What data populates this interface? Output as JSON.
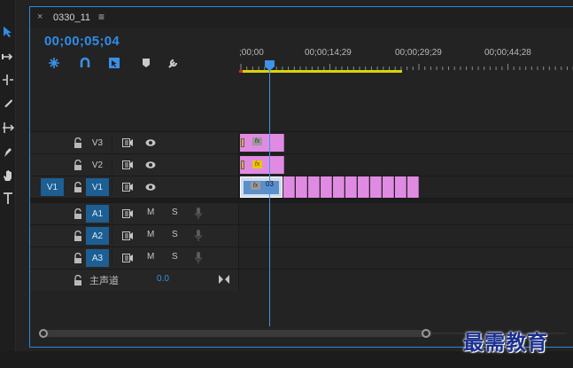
{
  "sequence": {
    "tab_title": "0330_11",
    "close_glyph": "×",
    "menu_glyph": "≡",
    "timecode": "00;00;05;04"
  },
  "header_icons": [
    "snap-insert-icon",
    "magnet-icon",
    "linked-selection-icon",
    "marker-icon",
    "wrench-icon"
  ],
  "ruler": {
    "labels": [
      ";00;00",
      "00;00;14;29",
      "00;00;29;29",
      "00;00;44;28"
    ]
  },
  "tracks": {
    "video": [
      {
        "name": "V3",
        "source": ""
      },
      {
        "name": "V2",
        "source": ""
      },
      {
        "name": "V1",
        "source": "V1"
      }
    ],
    "audio": [
      {
        "name": "A1",
        "mute": "M",
        "solo": "S"
      },
      {
        "name": "A2",
        "mute": "M",
        "solo": "S"
      },
      {
        "name": "A3",
        "mute": "M",
        "solo": "S"
      }
    ],
    "master": {
      "label": "主声道",
      "volume": "0.0"
    }
  },
  "clips": {
    "v3_fx": "fx",
    "v2_fx": "fx",
    "v1_fx": "fx",
    "v1_label": "03"
  },
  "colors": {
    "accent": "#2d8ceb",
    "clip_pink": "#e08be2",
    "work_area": "#d9d30e",
    "track_target": "#1d5f93"
  },
  "watermark": "最需教育"
}
